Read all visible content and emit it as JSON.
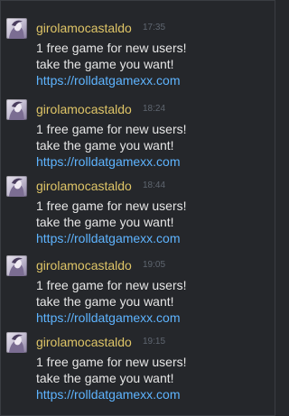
{
  "messages": [
    {
      "username": "girolamocastaldo",
      "time": "17:35",
      "line1": "1 free game for new users!",
      "line2": "take the game you want!",
      "link": "https://rolldatgamexx.com"
    },
    {
      "username": "girolamocastaldo",
      "time": "18:24",
      "line1": "1 free game for new users!",
      "line2": "take the game you want!",
      "link": "https://rolldatgamexx.com"
    },
    {
      "username": "girolamocastaldo",
      "time": "18:44",
      "line1": "1 free game for new users!",
      "line2": "take the game you want!",
      "link": "https://rolldatgamexx.com"
    },
    {
      "username": "girolamocastaldo",
      "time": "19:05",
      "line1": "1 free game for new users!",
      "line2": "take the game you want!",
      "link": "https://rolldatgamexx.com"
    },
    {
      "username": "girolamocastaldo",
      "time": "19:15",
      "line1": "1 free game for new users!",
      "line2": "take the game you want!",
      "link": "https://rolldatgamexx.com"
    }
  ],
  "colors": {
    "background": "#25272b",
    "username": "#dfc567",
    "timestamp": "#5f6670",
    "text": "#e6e6e6",
    "link": "#5eb4ff"
  },
  "icons": {
    "avatar": "user-avatar-icon"
  }
}
